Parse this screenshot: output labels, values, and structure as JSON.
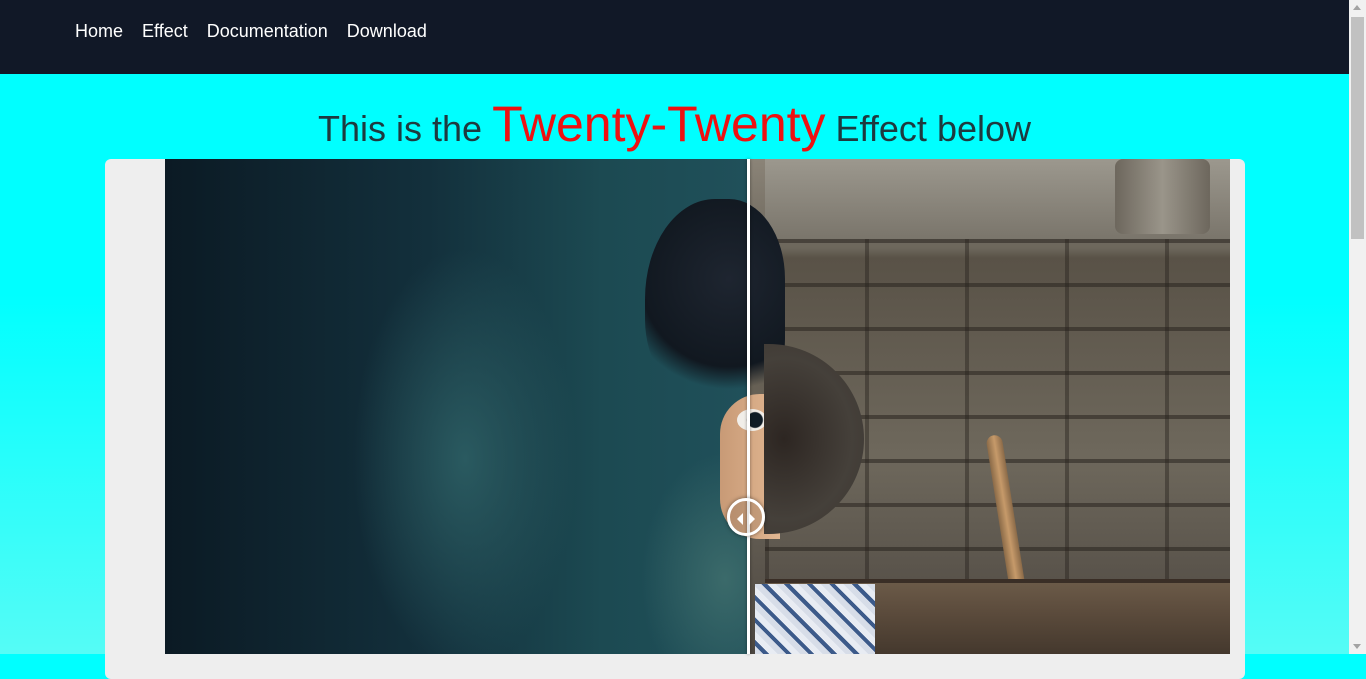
{
  "nav": {
    "items": [
      {
        "label": "Home"
      },
      {
        "label": "Effect"
      },
      {
        "label": "Documentation"
      },
      {
        "label": "Download"
      }
    ]
  },
  "headline": {
    "prefix": "This is the",
    "accent": "Twenty-Twenty",
    "suffix": "Effect below"
  },
  "comparison": {
    "handle_icon": "left-right-arrows-icon",
    "split_position": 0.55
  },
  "colors": {
    "nav_background": "#111827",
    "page_background": "#00ffff",
    "accent_text": "#ee1111"
  }
}
